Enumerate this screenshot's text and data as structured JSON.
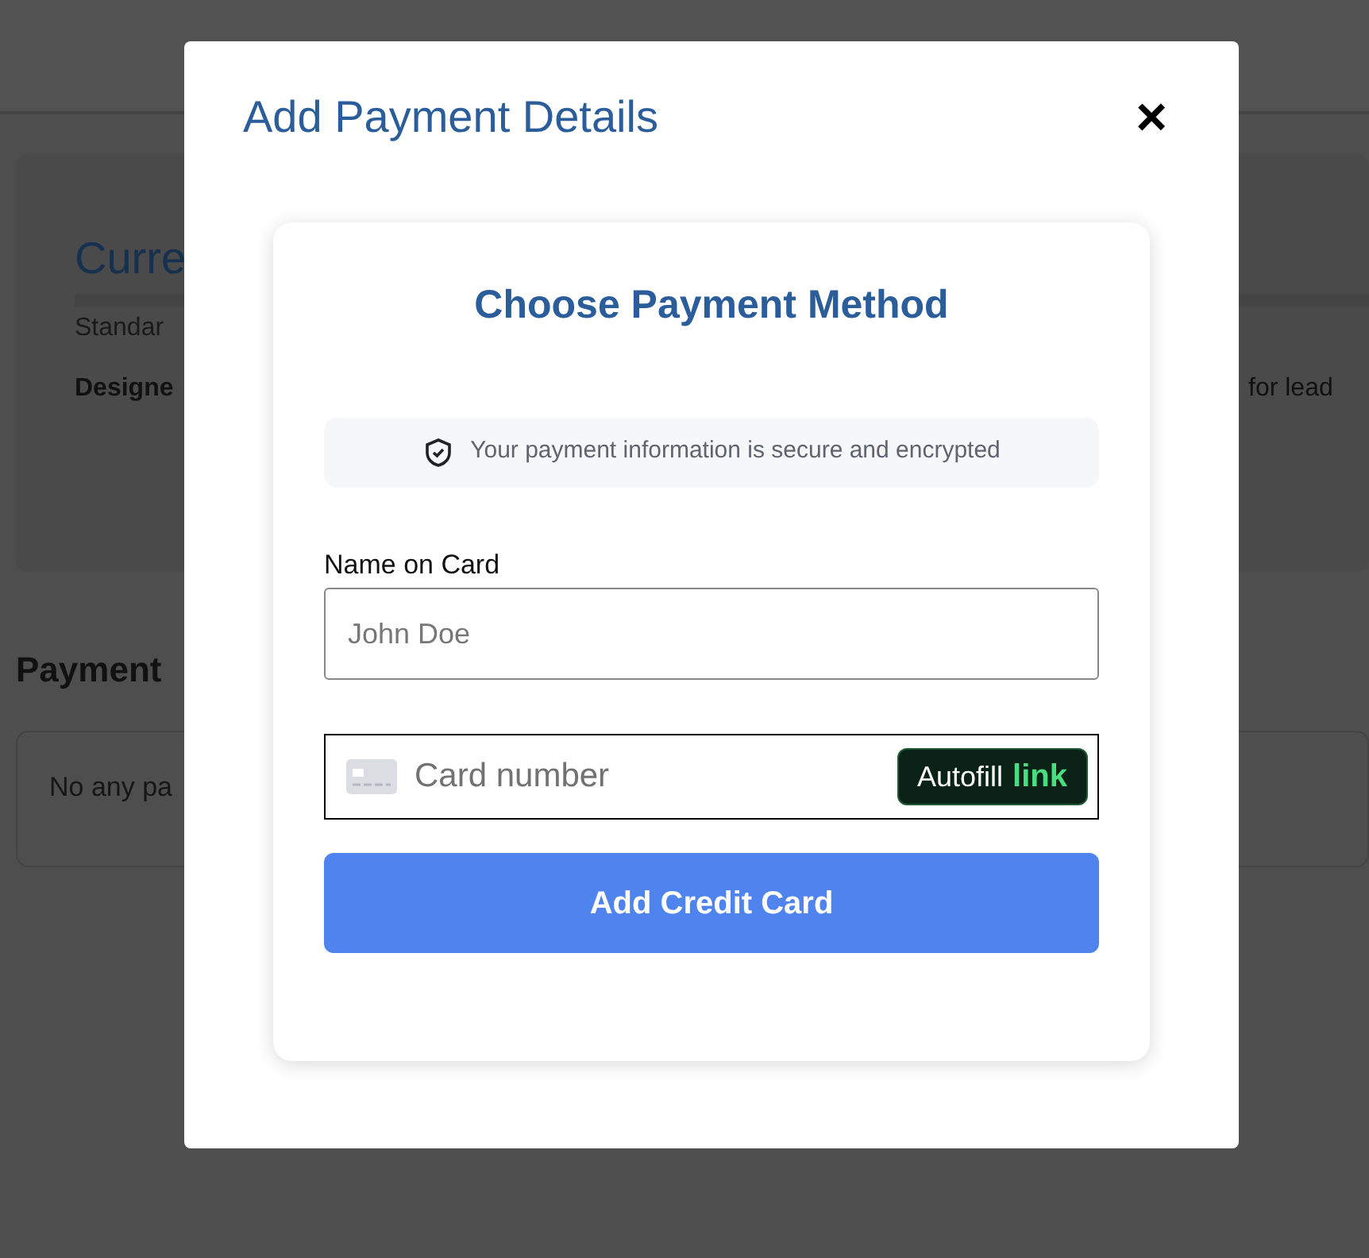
{
  "background_page": {
    "plan_card": {
      "title": "Curre",
      "line_1": "Standar",
      "line_2": "Designe",
      "line_2_end": "for lead"
    },
    "payment_section": {
      "heading": "Payment",
      "empty_note": "No any pa"
    }
  },
  "modal": {
    "title": "Add Payment Details",
    "close": "×",
    "form": {
      "heading": "Choose Payment Method",
      "notice": "Your payment information is secure and encrypted",
      "name_field": {
        "label": "Name on Card",
        "placeholder": "John Doe"
      },
      "card_field": {
        "placeholder": "Card number",
        "autofill_label": "Autofill",
        "autofill_brand": "link"
      },
      "submit": "Add Credit Card"
    }
  }
}
